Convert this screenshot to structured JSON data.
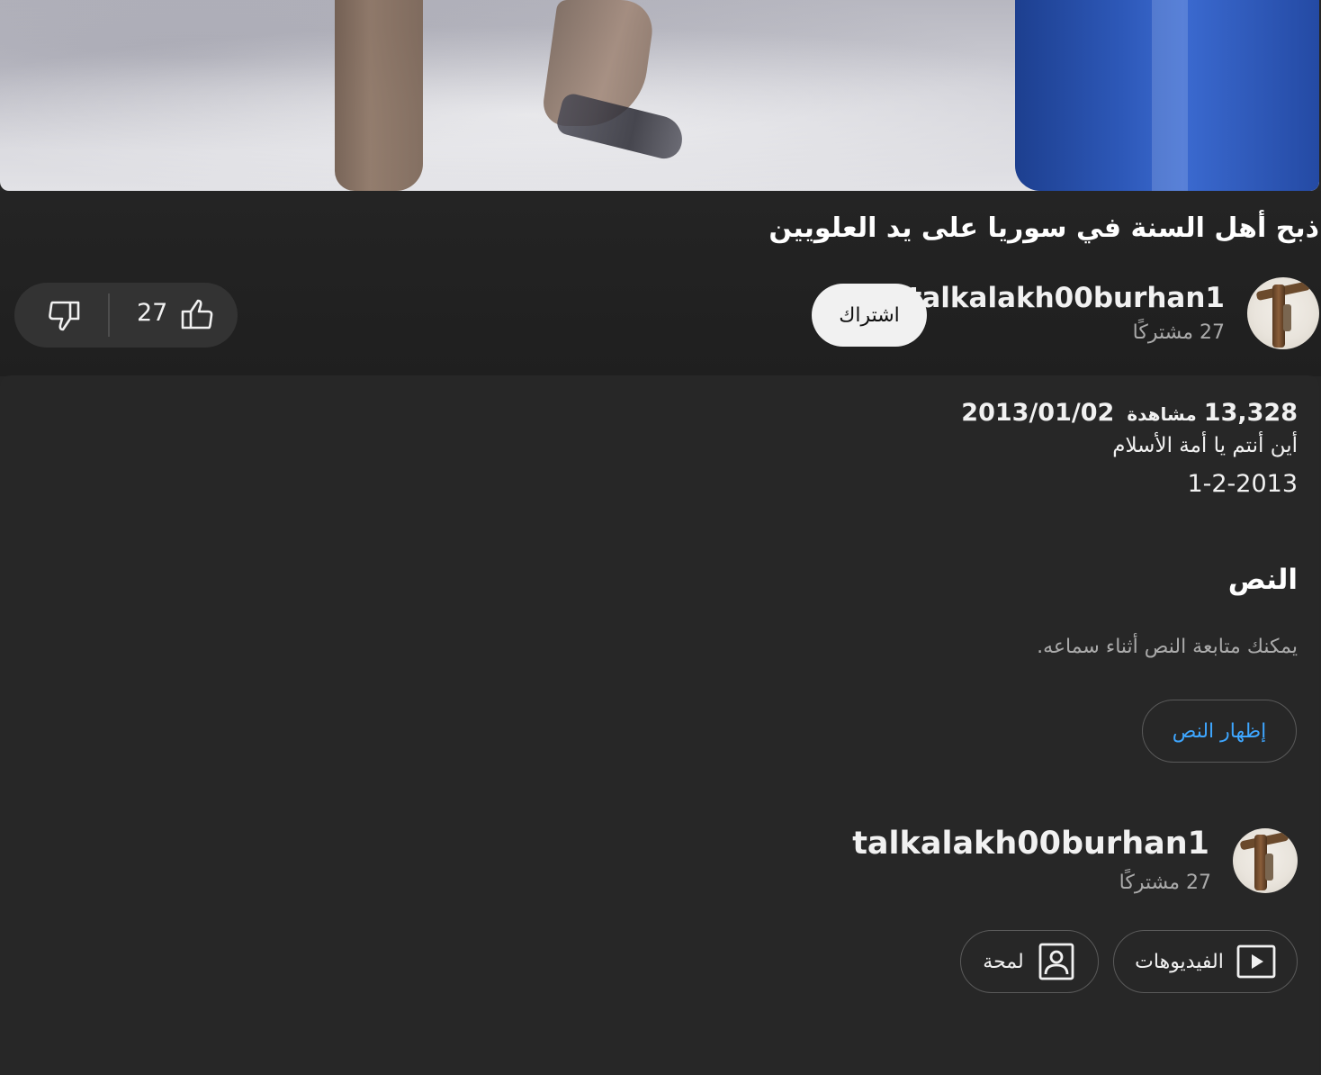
{
  "video": {
    "title": "ذبح أهل السنة في سوريا على يد العلويين"
  },
  "channel": {
    "name": "talkalakh00burhan1",
    "subscribers": "27 مشتركًا",
    "subscribe_label": "اشتراك"
  },
  "actions": {
    "like_count": "27",
    "like_icon": "thumbs-up-icon",
    "dislike_icon": "thumbs-down-icon"
  },
  "description": {
    "views": "13,328",
    "views_label": "مشاهدة",
    "date": "2013/01/02",
    "line1": "أين أنتم يا أمة الأسلام",
    "line2": "1-2-2013"
  },
  "transcript": {
    "title": "النص",
    "subtitle": "يمكنك متابعة النص أثناء سماعه.",
    "button_label": "إظهار النص"
  },
  "channel_footer": {
    "name": "talkalakh00burhan1",
    "subscribers": "27 مشتركًا",
    "videos_label": "الفيديوهات",
    "videos_icon": "play-box-icon",
    "about_label": "لمحة",
    "about_icon": "person-box-icon"
  },
  "colors": {
    "background": "#272727",
    "link_blue": "#3ea6ff",
    "subscribe_bg": "#f1f1f1"
  }
}
